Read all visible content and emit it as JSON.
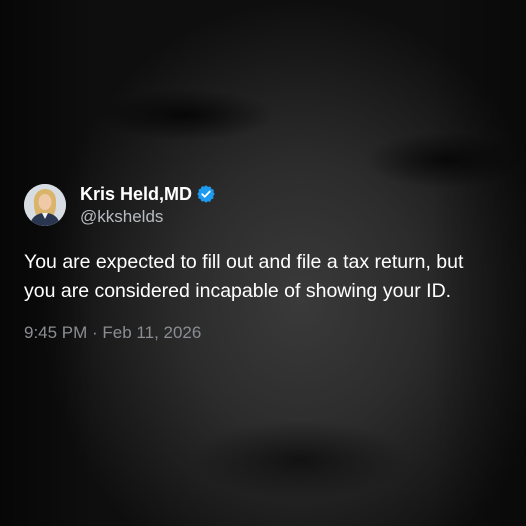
{
  "tweet": {
    "author": {
      "display_name": "Kris Held,MD",
      "handle": "@kkshelds",
      "verified": true
    },
    "text_lines": [
      "You are expected to fill out and file a tax return, but",
      "you are considered incapable of showing your ID."
    ],
    "timestamp": "9:45 PM · Feb 11, 2026"
  },
  "colors": {
    "verified_badge": "#1d9bf0",
    "text": "#ffffff",
    "handle": "#b8bcc0",
    "timestamp": "#8a8d91"
  },
  "icons": {
    "avatar": "avatar",
    "verified": "verified-badge-icon"
  }
}
